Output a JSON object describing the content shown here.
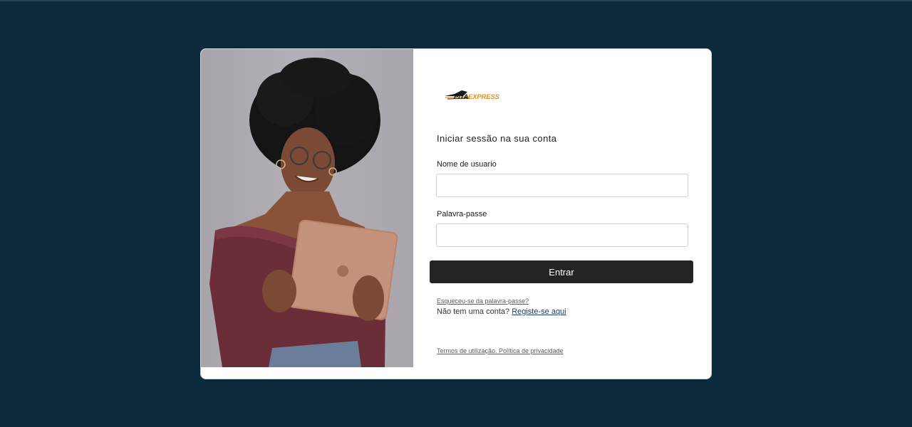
{
  "brand": {
    "logo_prefix": "PITA",
    "logo_suffix": "EXPRESS",
    "accent_color": "#e1901a"
  },
  "login": {
    "heading": "Iniciar sessão na sua conta",
    "username_label": "Nome de usuario",
    "username_value": "",
    "password_label": "Palavra-passe",
    "password_value": "",
    "submit_label": "Entrar",
    "forgot_link": "Esqueceu-se da palavra-passe?",
    "no_account_text": "Não tem uma conta?",
    "register_link": "Registe-se aqui",
    "terms_link": "Termos de utilização. Política de privacidade"
  },
  "colors": {
    "background": "#0b2a3b",
    "button": "#222428",
    "card": "#ffffff"
  }
}
